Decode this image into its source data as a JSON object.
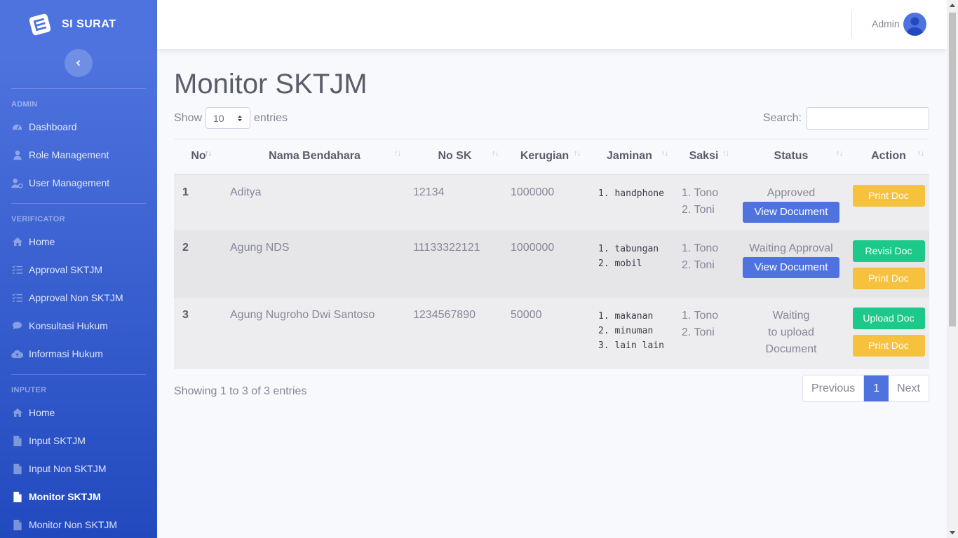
{
  "brand": {
    "name": "SI SURAT"
  },
  "sidebar": {
    "sections": [
      {
        "heading": "ADMIN",
        "items": [
          {
            "label": "Dashboard",
            "icon": "tachometer-icon"
          },
          {
            "label": "Role Management",
            "icon": "user-icon"
          },
          {
            "label": "User Management",
            "icon": "user-cog-icon"
          }
        ]
      },
      {
        "heading": "VERIFICATOR",
        "items": [
          {
            "label": "Home",
            "icon": "home-icon"
          },
          {
            "label": "Approval SKTJM",
            "icon": "list-check-icon"
          },
          {
            "label": "Approval Non SKTJM",
            "icon": "list-check-icon"
          },
          {
            "label": "Konsultasi Hukum",
            "icon": "comment-icon"
          },
          {
            "label": "Informasi Hukum",
            "icon": "cloud-upload-icon"
          }
        ]
      },
      {
        "heading": "INPUTER",
        "items": [
          {
            "label": "Home",
            "icon": "home-icon"
          },
          {
            "label": "Input SKTJM",
            "icon": "file-icon"
          },
          {
            "label": "Input Non SKTJM",
            "icon": "file-icon"
          },
          {
            "label": "Monitor SKTJM",
            "icon": "file-icon",
            "active": true
          },
          {
            "label": "Monitor Non SKTJM",
            "icon": "file-icon"
          }
        ]
      }
    ]
  },
  "topbar": {
    "user_name": "Admin"
  },
  "page": {
    "title": "Monitor SKTJM",
    "show_label": "Show",
    "entries_label": "entries",
    "page_length": "10",
    "search_label": "Search:",
    "search_value": ""
  },
  "table": {
    "columns": [
      "No",
      "Nama Bendahara",
      "No SK",
      "Kerugian",
      "Jaminan",
      "Saksi",
      "Status",
      "Action"
    ],
    "rows": [
      {
        "no": "1",
        "nama": "Aditya",
        "no_sk": "12134",
        "kerugian": "1000000",
        "jaminan": [
          "handphone"
        ],
        "saksi": [
          "Tono",
          "Toni"
        ],
        "status": [
          "Approved"
        ],
        "view_button": "View Document",
        "actions": [
          {
            "label": "Print Doc",
            "type": "warning"
          }
        ]
      },
      {
        "no": "2",
        "nama": "Agung NDS",
        "no_sk": "11133322121",
        "kerugian": "1000000",
        "jaminan": [
          "tabungan",
          "mobil"
        ],
        "saksi": [
          "Tono",
          "Toni"
        ],
        "status": [
          "Waiting Approval"
        ],
        "view_button": "View Document",
        "actions": [
          {
            "label": "Revisi Doc",
            "type": "success"
          },
          {
            "label": "Print Doc",
            "type": "warning"
          }
        ]
      },
      {
        "no": "3",
        "nama": "Agung Nugroho Dwi Santoso",
        "no_sk": "1234567890",
        "kerugian": "50000",
        "jaminan": [
          "makanan",
          "minuman",
          "lain lain"
        ],
        "saksi": [
          "Tono",
          "Toni"
        ],
        "status": [
          "Waiting",
          "to upload",
          "Document"
        ],
        "view_button": "",
        "actions": [
          {
            "label": "Upload Doc",
            "type": "success"
          },
          {
            "label": "Print Doc",
            "type": "warning"
          }
        ]
      }
    ]
  },
  "footer": {
    "info": "Showing 1 to 3 of 3 entries",
    "previous": "Previous",
    "current_page": "1",
    "next": "Next"
  },
  "colors": {
    "primary": "#4e73df",
    "warning": "#f6c23e",
    "success": "#1cc88a"
  }
}
